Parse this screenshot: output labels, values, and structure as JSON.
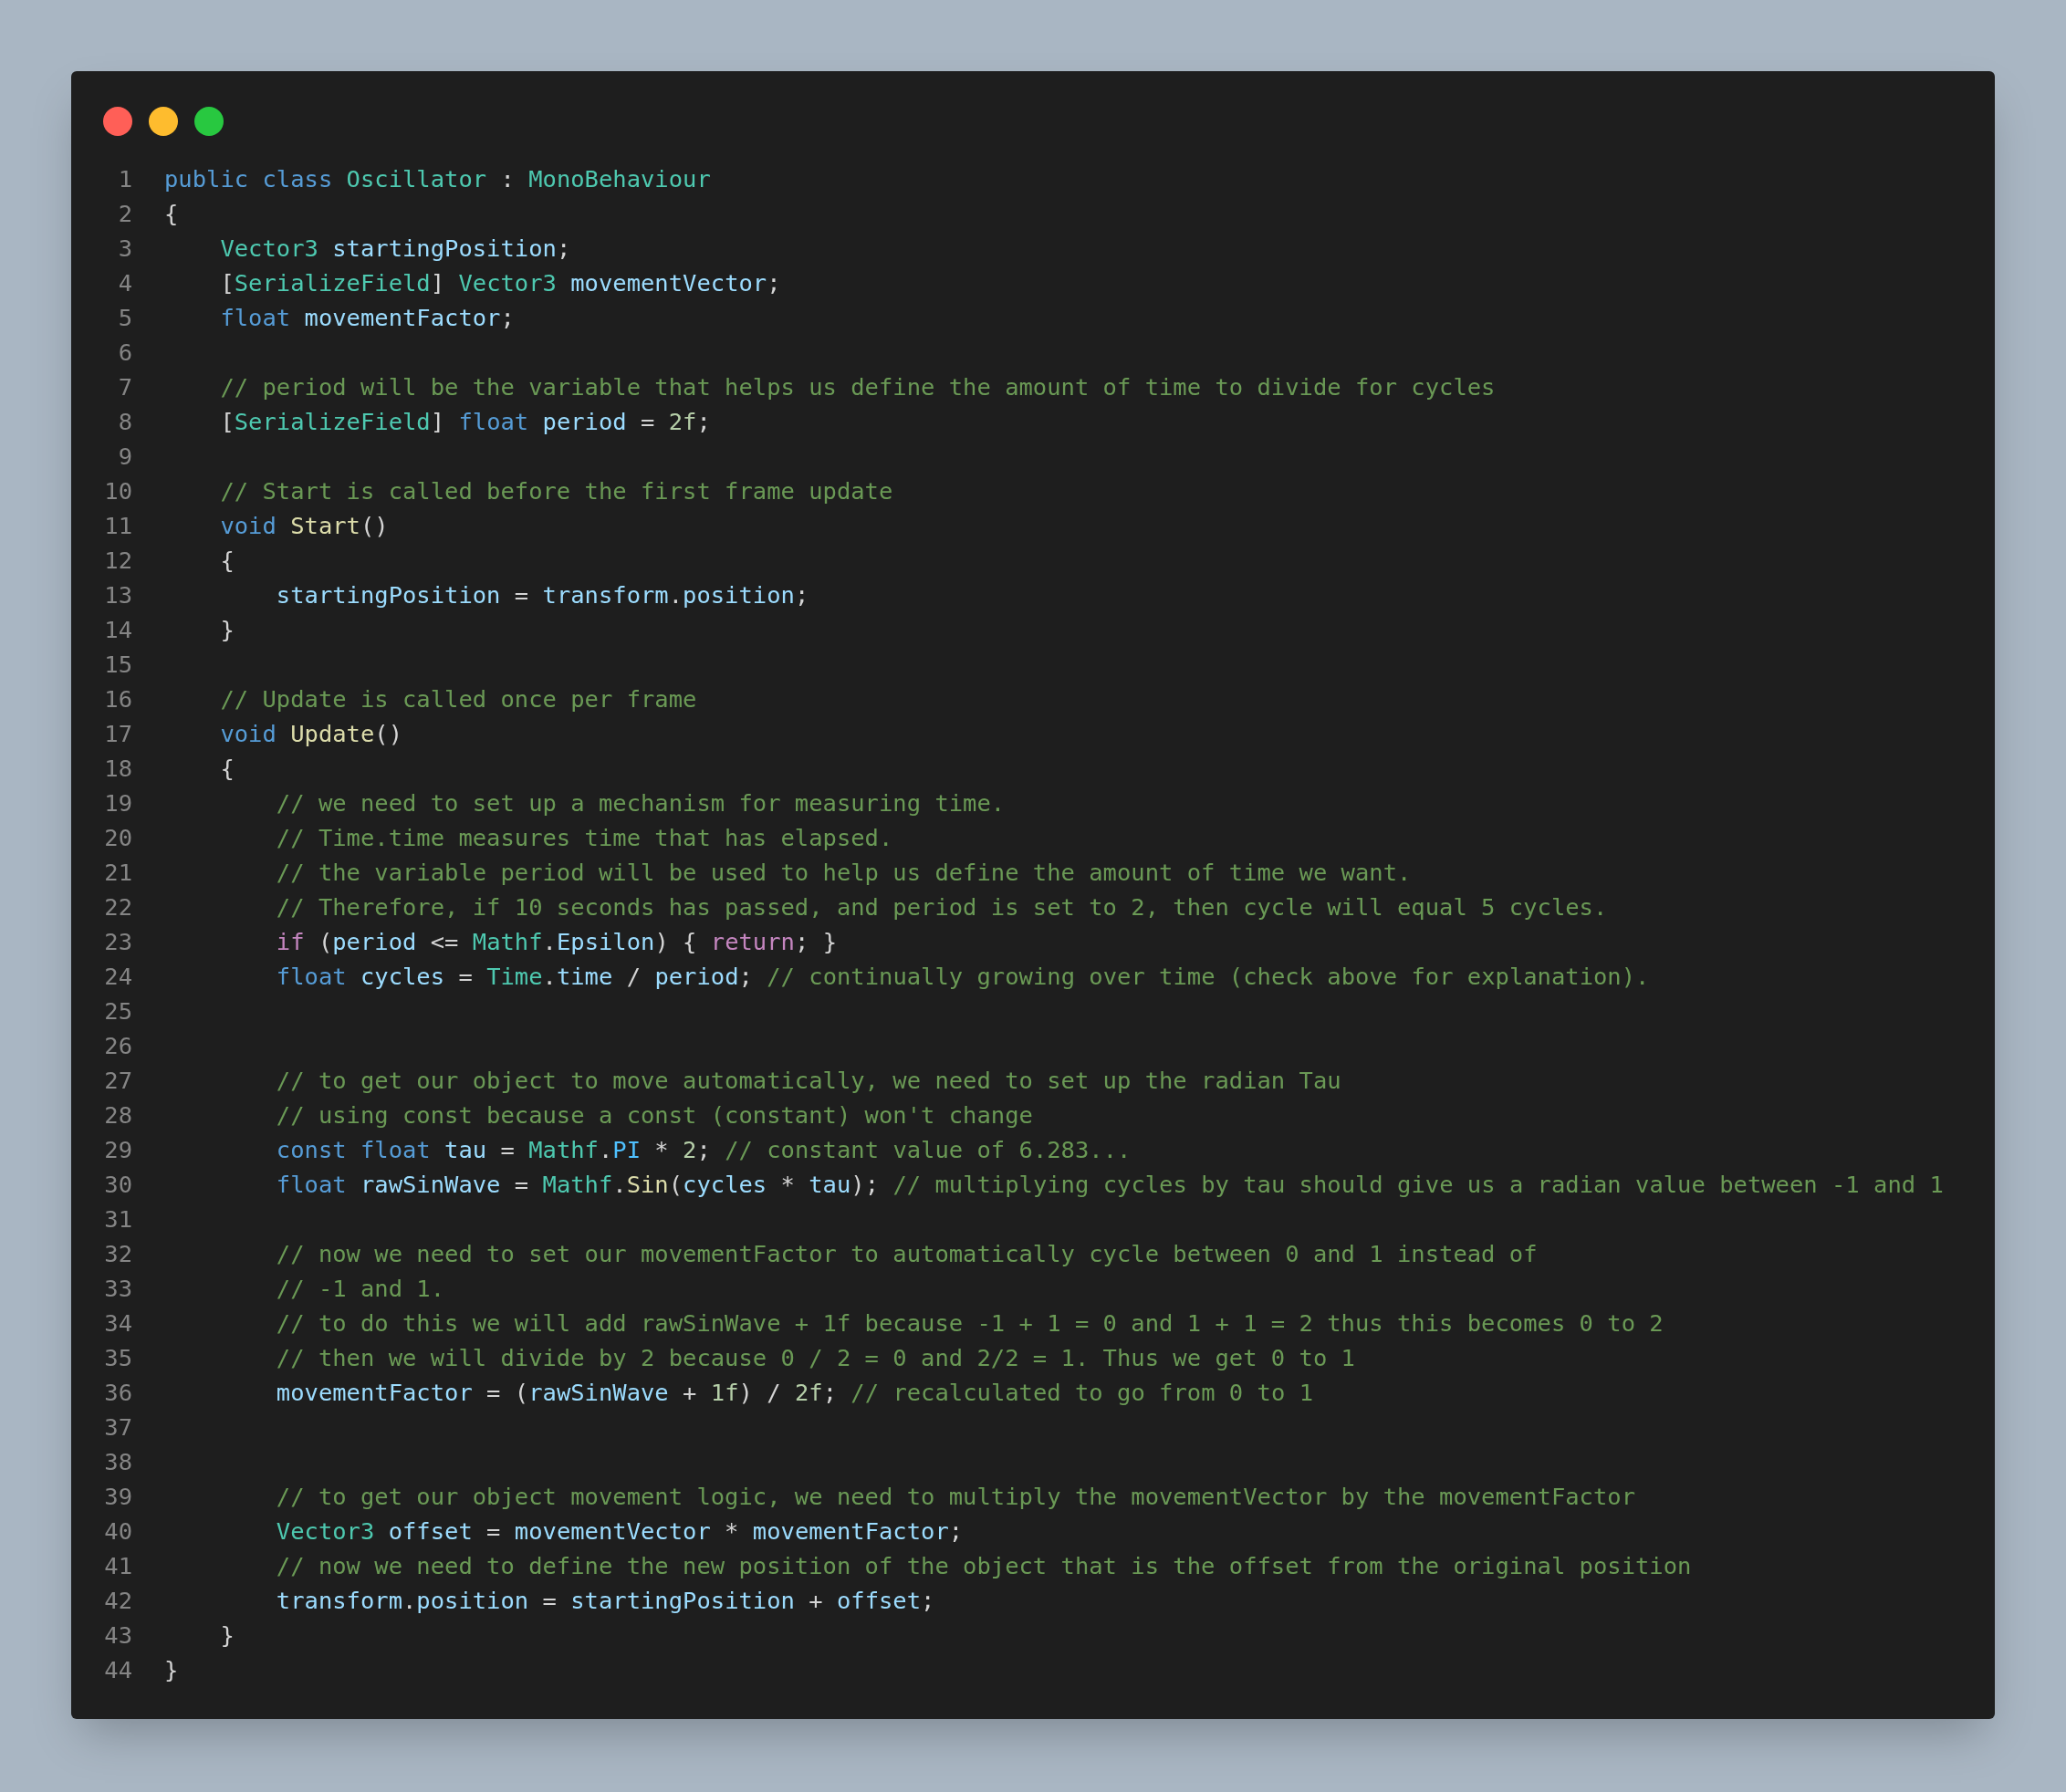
{
  "window_controls": [
    {
      "color": "#ff5f57"
    },
    {
      "color": "#febc2e"
    },
    {
      "color": "#28c840"
    }
  ],
  "lines": [
    {
      "number": "1",
      "tokens": [
        {
          "kind": "keyword",
          "text": "public class "
        },
        {
          "kind": "type",
          "text": "Oscillator"
        },
        {
          "kind": "plain",
          "text": " : "
        },
        {
          "kind": "type",
          "text": "MonoBehaviour"
        }
      ]
    },
    {
      "number": "2",
      "tokens": [
        {
          "kind": "plain",
          "text": "{"
        }
      ]
    },
    {
      "number": "3",
      "tokens": [
        {
          "kind": "type",
          "text": "    Vector3 "
        },
        {
          "kind": "var",
          "text": "startingPosition"
        },
        {
          "kind": "plain",
          "text": ";"
        }
      ]
    },
    {
      "number": "4",
      "tokens": [
        {
          "kind": "plain",
          "text": "    ["
        },
        {
          "kind": "type",
          "text": "SerializeField"
        },
        {
          "kind": "plain",
          "text": "] "
        },
        {
          "kind": "type",
          "text": "Vector3 "
        },
        {
          "kind": "var",
          "text": "movementVector"
        },
        {
          "kind": "plain",
          "text": ";"
        }
      ]
    },
    {
      "number": "5",
      "tokens": [
        {
          "kind": "keyword",
          "text": "    float "
        },
        {
          "kind": "var",
          "text": "movementFactor"
        },
        {
          "kind": "plain",
          "text": ";"
        }
      ]
    },
    {
      "number": "6"
    },
    {
      "number": "7",
      "tokens": [
        {
          "kind": "comment",
          "text": "    // period will be the variable that helps us define the amount of time to divide for cycles"
        }
      ]
    },
    {
      "number": "8",
      "tokens": [
        {
          "kind": "plain",
          "text": "    ["
        },
        {
          "kind": "type",
          "text": "SerializeField"
        },
        {
          "kind": "plain",
          "text": "] "
        },
        {
          "kind": "keyword",
          "text": "float "
        },
        {
          "kind": "var",
          "text": "period"
        },
        {
          "kind": "plain",
          "text": " = "
        },
        {
          "kind": "number",
          "text": "2f"
        },
        {
          "kind": "plain",
          "text": ";"
        }
      ]
    },
    {
      "number": "9"
    },
    {
      "number": "10",
      "tokens": [
        {
          "kind": "comment",
          "text": "    // Start is called before the first frame update"
        }
      ]
    },
    {
      "number": "11",
      "tokens": [
        {
          "kind": "keyword",
          "text": "    void "
        },
        {
          "kind": "func",
          "text": "Start"
        },
        {
          "kind": "plain",
          "text": "()"
        }
      ]
    },
    {
      "number": "12",
      "tokens": [
        {
          "kind": "plain",
          "text": "    {"
        }
      ]
    },
    {
      "number": "13",
      "tokens": [
        {
          "kind": "var",
          "text": "        startingPosition"
        },
        {
          "kind": "plain",
          "text": " = "
        },
        {
          "kind": "var",
          "text": "transform"
        },
        {
          "kind": "plain",
          "text": "."
        },
        {
          "kind": "var",
          "text": "position"
        },
        {
          "kind": "plain",
          "text": ";"
        }
      ]
    },
    {
      "number": "14",
      "tokens": [
        {
          "kind": "plain",
          "text": "    }"
        }
      ]
    },
    {
      "number": "15"
    },
    {
      "number": "16",
      "tokens": [
        {
          "kind": "comment",
          "text": "    // Update is called once per frame"
        }
      ]
    },
    {
      "number": "17",
      "tokens": [
        {
          "kind": "keyword",
          "text": "    void "
        },
        {
          "kind": "func",
          "text": "Update"
        },
        {
          "kind": "plain",
          "text": "()"
        }
      ]
    },
    {
      "number": "18",
      "tokens": [
        {
          "kind": "plain",
          "text": "    {"
        }
      ]
    },
    {
      "number": "19",
      "tokens": [
        {
          "kind": "comment",
          "text": "        // we need to set up a mechanism for measuring time."
        }
      ]
    },
    {
      "number": "20",
      "tokens": [
        {
          "kind": "comment",
          "text": "        // Time.time measures time that has elapsed."
        }
      ]
    },
    {
      "number": "21",
      "tokens": [
        {
          "kind": "comment",
          "text": "        // the variable period will be used to help us define the amount of time we want."
        }
      ]
    },
    {
      "number": "22",
      "tokens": [
        {
          "kind": "comment",
          "text": "        // Therefore, if 10 seconds has passed, and period is set to 2, then cycle will equal 5 cycles."
        }
      ]
    },
    {
      "number": "23",
      "tokens": [
        {
          "kind": "control",
          "text": "        if"
        },
        {
          "kind": "plain",
          "text": " ("
        },
        {
          "kind": "var",
          "text": "period"
        },
        {
          "kind": "plain",
          "text": " <= "
        },
        {
          "kind": "type",
          "text": "Mathf"
        },
        {
          "kind": "plain",
          "text": "."
        },
        {
          "kind": "var",
          "text": "Epsilon"
        },
        {
          "kind": "plain",
          "text": ") { "
        },
        {
          "kind": "control",
          "text": "return"
        },
        {
          "kind": "plain",
          "text": "; }"
        }
      ]
    },
    {
      "number": "24",
      "tokens": [
        {
          "kind": "keyword",
          "text": "        float "
        },
        {
          "kind": "var",
          "text": "cycles"
        },
        {
          "kind": "plain",
          "text": " = "
        },
        {
          "kind": "type",
          "text": "Time"
        },
        {
          "kind": "plain",
          "text": "."
        },
        {
          "kind": "var",
          "text": "time"
        },
        {
          "kind": "plain",
          "text": " / "
        },
        {
          "kind": "var",
          "text": "period"
        },
        {
          "kind": "plain",
          "text": "; "
        },
        {
          "kind": "comment",
          "text": "// continually growing over time (check above for explanation)."
        }
      ]
    },
    {
      "number": "25"
    },
    {
      "number": "26"
    },
    {
      "number": "27",
      "tokens": [
        {
          "kind": "comment",
          "text": "        // to get our object to move automatically, we need to set up the radian Tau"
        }
      ]
    },
    {
      "number": "28",
      "tokens": [
        {
          "kind": "comment",
          "text": "        // using const because a const (constant) won't change"
        }
      ]
    },
    {
      "number": "29",
      "tokens": [
        {
          "kind": "keyword",
          "text": "        const float "
        },
        {
          "kind": "var",
          "text": "tau"
        },
        {
          "kind": "plain",
          "text": " = "
        },
        {
          "kind": "type",
          "text": "Mathf"
        },
        {
          "kind": "plain",
          "text": "."
        },
        {
          "kind": "constant",
          "text": "PI"
        },
        {
          "kind": "plain",
          "text": " * "
        },
        {
          "kind": "number",
          "text": "2"
        },
        {
          "kind": "plain",
          "text": "; "
        },
        {
          "kind": "comment",
          "text": "// constant value of 6.283..."
        }
      ]
    },
    {
      "number": "30",
      "tokens": [
        {
          "kind": "keyword",
          "text": "        float "
        },
        {
          "kind": "var",
          "text": "rawSinWave"
        },
        {
          "kind": "plain",
          "text": " = "
        },
        {
          "kind": "type",
          "text": "Mathf"
        },
        {
          "kind": "plain",
          "text": "."
        },
        {
          "kind": "func",
          "text": "Sin"
        },
        {
          "kind": "plain",
          "text": "("
        },
        {
          "kind": "var",
          "text": "cycles"
        },
        {
          "kind": "plain",
          "text": " * "
        },
        {
          "kind": "var",
          "text": "tau"
        },
        {
          "kind": "plain",
          "text": "); "
        },
        {
          "kind": "comment",
          "text": "// multiplying cycles by tau should give us a radian value between -1 and 1"
        }
      ]
    },
    {
      "number": "31"
    },
    {
      "number": "32",
      "tokens": [
        {
          "kind": "comment",
          "text": "        // now we need to set our movementFactor to automatically cycle between 0 and 1 instead of"
        }
      ]
    },
    {
      "number": "33",
      "tokens": [
        {
          "kind": "comment",
          "text": "        // -1 and 1."
        }
      ]
    },
    {
      "number": "34",
      "tokens": [
        {
          "kind": "comment",
          "text": "        // to do this we will add rawSinWave + 1f because -1 + 1 = 0 and 1 + 1 = 2 thus this becomes 0 to 2"
        }
      ]
    },
    {
      "number": "35",
      "tokens": [
        {
          "kind": "comment",
          "text": "        // then we will divide by 2 because 0 / 2 = 0 and 2/2 = 1. Thus we get 0 to 1"
        }
      ]
    },
    {
      "number": "36",
      "tokens": [
        {
          "kind": "var",
          "text": "        movementFactor"
        },
        {
          "kind": "plain",
          "text": " = ("
        },
        {
          "kind": "var",
          "text": "rawSinWave"
        },
        {
          "kind": "plain",
          "text": " + "
        },
        {
          "kind": "number",
          "text": "1f"
        },
        {
          "kind": "plain",
          "text": ") / "
        },
        {
          "kind": "number",
          "text": "2f"
        },
        {
          "kind": "plain",
          "text": "; "
        },
        {
          "kind": "comment",
          "text": "// recalculated to go from 0 to 1"
        }
      ]
    },
    {
      "number": "37"
    },
    {
      "number": "38"
    },
    {
      "number": "39",
      "tokens": [
        {
          "kind": "comment",
          "text": "        // to get our object movement logic, we need to multiply the movementVector by the movementFactor"
        }
      ]
    },
    {
      "number": "40",
      "tokens": [
        {
          "kind": "type",
          "text": "        Vector3 "
        },
        {
          "kind": "var",
          "text": "offset"
        },
        {
          "kind": "plain",
          "text": " = "
        },
        {
          "kind": "var",
          "text": "movementVector"
        },
        {
          "kind": "plain",
          "text": " * "
        },
        {
          "kind": "var",
          "text": "movementFactor"
        },
        {
          "kind": "plain",
          "text": ";"
        }
      ]
    },
    {
      "number": "41",
      "tokens": [
        {
          "kind": "comment",
          "text": "        // now we need to define the new position of the object that is the offset from the original position"
        }
      ]
    },
    {
      "number": "42",
      "tokens": [
        {
          "kind": "var",
          "text": "        transform"
        },
        {
          "kind": "plain",
          "text": "."
        },
        {
          "kind": "var",
          "text": "position"
        },
        {
          "kind": "plain",
          "text": " = "
        },
        {
          "kind": "var",
          "text": "startingPosition"
        },
        {
          "kind": "plain",
          "text": " + "
        },
        {
          "kind": "var",
          "text": "offset"
        },
        {
          "kind": "plain",
          "text": ";"
        }
      ]
    },
    {
      "number": "43",
      "tokens": [
        {
          "kind": "plain",
          "text": "    }"
        }
      ]
    },
    {
      "number": "44",
      "tokens": [
        {
          "kind": "plain",
          "text": "}"
        }
      ]
    }
  ]
}
